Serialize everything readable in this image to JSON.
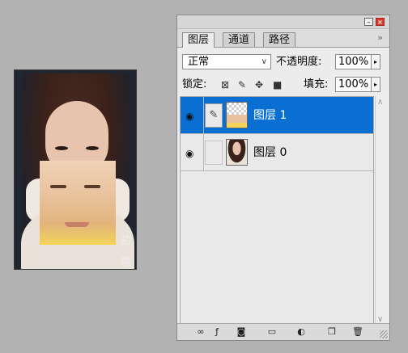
{
  "canvas": {
    "watermark": [
      "初",
      "曉"
    ]
  },
  "panel": {
    "tabs": [
      "图层",
      "通道",
      "路径"
    ],
    "blend_mode": "正常",
    "opacity_label": "不透明度:",
    "opacity_value": "100%",
    "lock_label": "锁定:",
    "fill_label": "填充:",
    "fill_value": "100%",
    "layers": [
      {
        "name": "图层 1",
        "selected": true,
        "visible": true
      },
      {
        "name": "图层 0",
        "selected": false,
        "visible": true
      }
    ],
    "icons": {
      "titlebar": [
        "minimize-icon",
        "close-icon"
      ],
      "lock": [
        "lock-transparent-icon",
        "lock-image-icon",
        "lock-position-icon",
        "lock-all-icon"
      ],
      "bottom": [
        "link-layers-icon",
        "layer-style-icon",
        "layer-mask-icon",
        "new-group-icon",
        "adjustment-layer-icon",
        "new-layer-icon",
        "delete-layer-icon"
      ]
    },
    "colors": {
      "selection": "#0a6fd3",
      "close": "#d93a2d"
    }
  }
}
